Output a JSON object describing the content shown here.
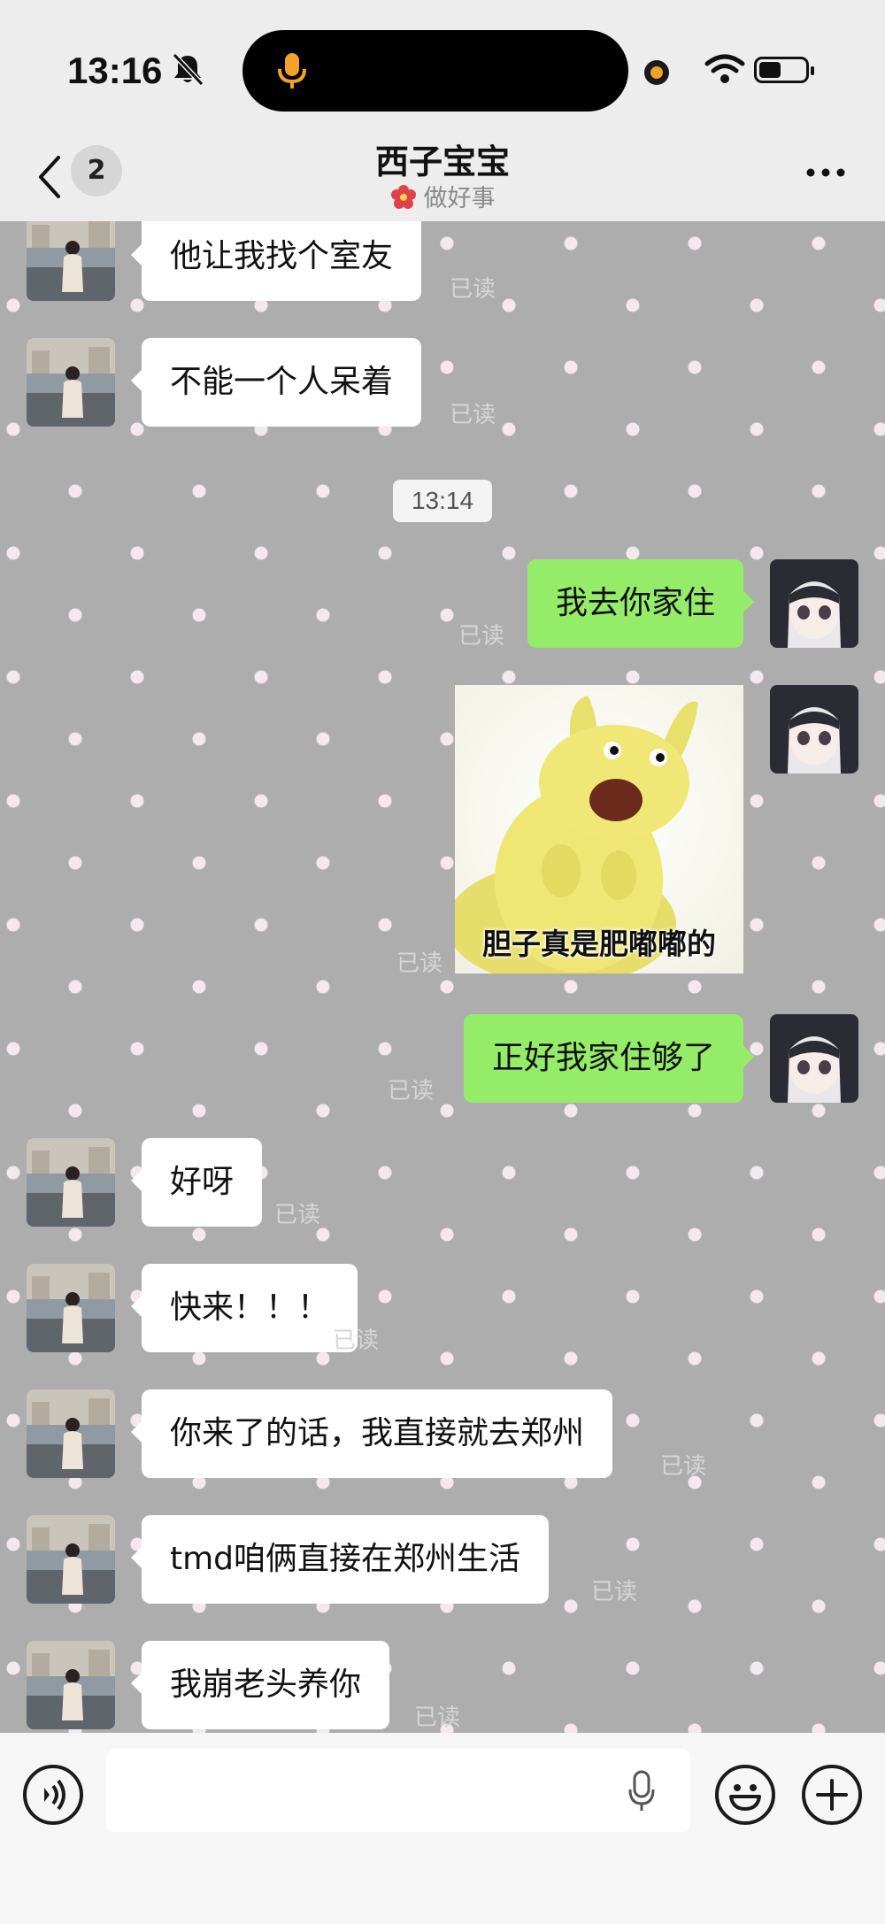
{
  "status_bar": {
    "time": "13:16"
  },
  "header": {
    "unread_count": "2",
    "title": "西子宝宝",
    "subtitle": "做好事"
  },
  "colors": {
    "out_bubble": "#95ec69",
    "in_bubble": "#ffffff",
    "chat_bg": "#adadad",
    "dots": "#f3e8ee"
  },
  "messages": [
    {
      "side": "in",
      "text": "他让我找个室友",
      "read": "已读"
    },
    {
      "side": "in",
      "text": "不能一个人呆着",
      "read": "已读"
    },
    {
      "type": "timestamp",
      "text": "13:14"
    },
    {
      "side": "out",
      "text": "我去你家住",
      "read": "已读"
    },
    {
      "side": "out",
      "type": "sticker",
      "caption": "胆子真是肥嘟嘟的",
      "read": "已读"
    },
    {
      "side": "out",
      "text": "正好我家住够了",
      "read": "已读"
    },
    {
      "side": "in",
      "text": "好呀",
      "read": "已读"
    },
    {
      "side": "in",
      "text": "快来！！！",
      "read": "已读"
    },
    {
      "side": "in",
      "text": "你来了的话，我直接就去郑州",
      "read": "已读"
    },
    {
      "side": "in",
      "text": "tmd咱俩直接在郑州生活",
      "read": "已读"
    },
    {
      "side": "in",
      "text": "我崩老头养你",
      "read": "已读"
    }
  ],
  "input_bar": {
    "voice_icon": "voice-mode-icon",
    "mic_icon": "microphone-icon",
    "emoji_icon": "emoji-icon",
    "plus_icon": "plus-icon"
  }
}
